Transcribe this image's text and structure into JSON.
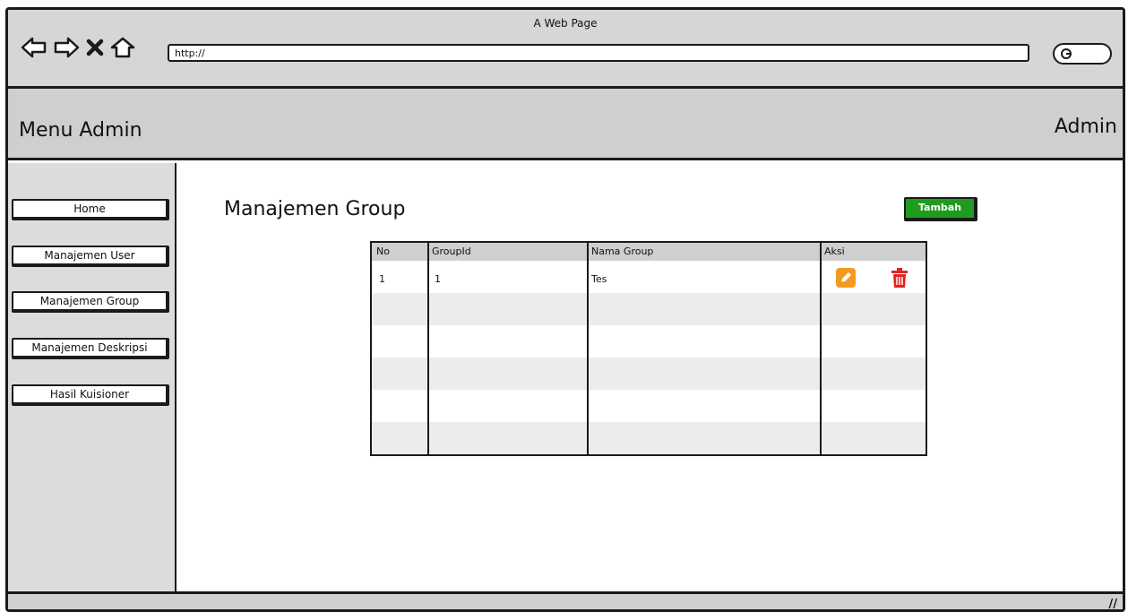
{
  "browser": {
    "window_title": "A Web Page",
    "url": "http://"
  },
  "header": {
    "app_title": "Menu Admin",
    "user": "Admin"
  },
  "sidebar": {
    "items": [
      {
        "label": "Home"
      },
      {
        "label": "Manajemen User"
      },
      {
        "label": "Manajemen Group"
      },
      {
        "label": "Manajemen Deskripsi"
      },
      {
        "label": "Hasil Kuisioner"
      }
    ]
  },
  "main": {
    "title": "Manajemen Group",
    "add_button": "Tambah",
    "table": {
      "columns": [
        "No",
        "GroupId",
        "Nama Group",
        "Aksi"
      ],
      "rows": [
        {
          "no": "1",
          "group_id": "1",
          "nama_group": "Tes"
        }
      ]
    }
  },
  "icons": {
    "edit": "pencil-icon",
    "delete": "trash-icon"
  },
  "colors": {
    "add_button": "#1f9c1f",
    "edit_icon": "#f39a1e",
    "delete_icon": "#e02424"
  }
}
